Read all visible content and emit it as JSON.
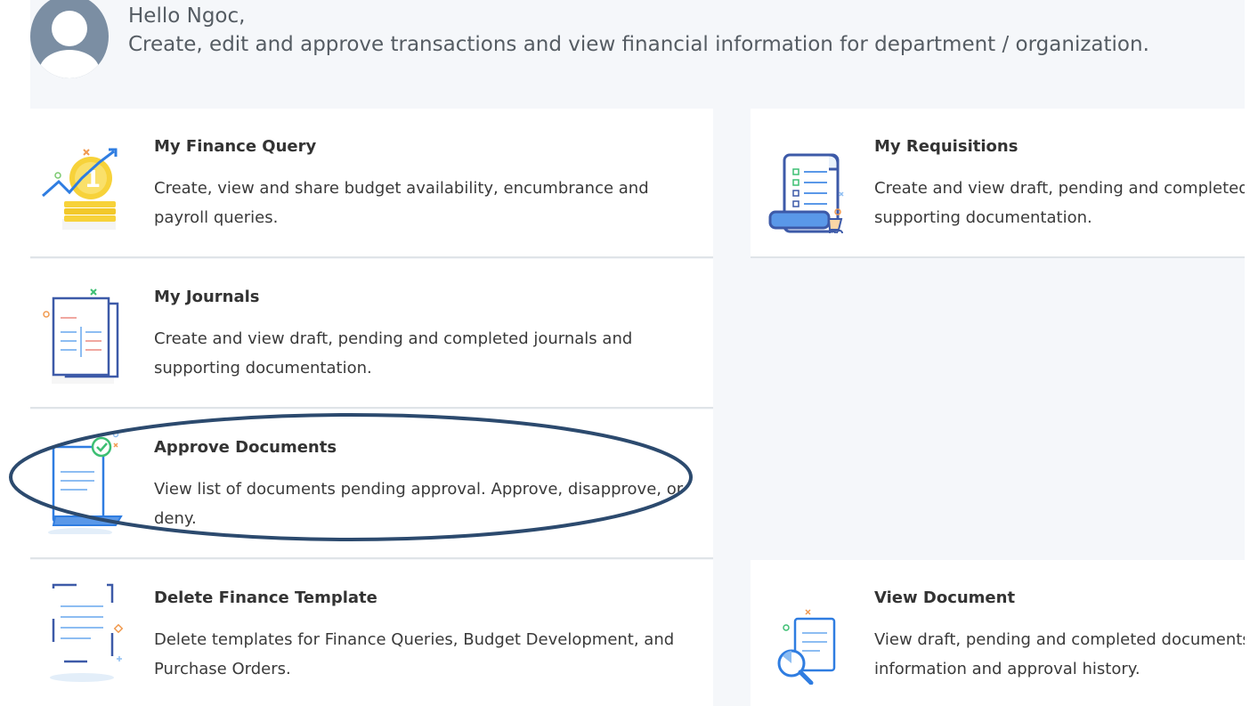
{
  "header": {
    "greeting": "Hello Ngoc,",
    "subtitle": "Create, edit and approve transactions and view financial information for department / organization."
  },
  "cards": [
    {
      "title": "My Finance Query",
      "description": "Create, view and share budget availability, encumbrance and payroll queries.",
      "icon": "coin-chart-icon"
    },
    {
      "title": "My Requisitions",
      "description": "Create and view draft, pending and completed\nsupporting documentation.",
      "icon": "requisition-cart-icon"
    },
    {
      "title": "My Journals",
      "description": "Create and view draft, pending and completed journals and supporting documentation.",
      "icon": "journal-icon"
    },
    {
      "title": "Approve Documents",
      "description": "View list of documents pending approval. Approve, disapprove, or deny.",
      "icon": "approve-document-icon"
    },
    {
      "title": "Delete Finance Template",
      "description": "Delete templates for Finance Queries, Budget Development, and Purchase Orders.",
      "icon": "template-icon"
    },
    {
      "title": "View Document",
      "description": "View draft, pending and completed documents\ninformation and approval history.",
      "icon": "view-document-icon"
    }
  ],
  "colors": {
    "accent_blue": "#2f7de1",
    "highlight_ellipse": "#2c4a6e",
    "coin_yellow": "#f7d23a"
  }
}
